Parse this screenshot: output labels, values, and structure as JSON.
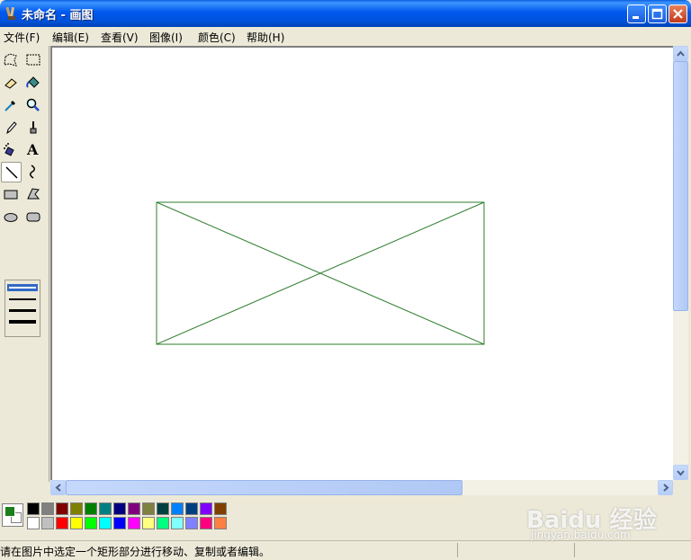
{
  "window": {
    "title": "未命名 - 画图"
  },
  "menu": [
    "文件(F)",
    "编辑(E)",
    "查看(V)",
    "图像(I)",
    "颜色(C)",
    "帮助(H)"
  ],
  "tools": [
    {
      "name": "free-select-tool",
      "icon": "free-select-icon"
    },
    {
      "name": "rect-select-tool",
      "icon": "rect-select-icon"
    },
    {
      "name": "eraser-tool",
      "icon": "eraser-icon"
    },
    {
      "name": "fill-tool",
      "icon": "paint-bucket-icon"
    },
    {
      "name": "pick-color-tool",
      "icon": "eyedropper-icon"
    },
    {
      "name": "magnifier-tool",
      "icon": "magnifier-icon"
    },
    {
      "name": "pencil-tool",
      "icon": "pencil-icon"
    },
    {
      "name": "brush-tool",
      "icon": "brush-icon"
    },
    {
      "name": "airbrush-tool",
      "icon": "airbrush-icon"
    },
    {
      "name": "text-tool",
      "icon": "text-icon",
      "glyph": "A"
    },
    {
      "name": "line-tool",
      "icon": "line-icon",
      "selected": true
    },
    {
      "name": "curve-tool",
      "icon": "curve-icon"
    },
    {
      "name": "rectangle-tool",
      "icon": "rectangle-icon"
    },
    {
      "name": "polygon-tool",
      "icon": "polygon-icon"
    },
    {
      "name": "ellipse-tool",
      "icon": "ellipse-icon"
    },
    {
      "name": "rounded-rect-tool",
      "icon": "rounded-rect-icon"
    }
  ],
  "line_sizes": {
    "selected_index": 0,
    "count": 4
  },
  "colors": {
    "foreground": "#1a7f1a",
    "background": "#ffffff",
    "stroke": "#2e7d2e",
    "palette_top": [
      "#000000",
      "#808080",
      "#800000",
      "#808000",
      "#008000",
      "#008080",
      "#000080",
      "#800080",
      "#808040",
      "#004040",
      "#0080ff",
      "#004080",
      "#8000ff",
      "#804000"
    ],
    "palette_bottom": [
      "#ffffff",
      "#c0c0c0",
      "#ff0000",
      "#ffff00",
      "#00ff00",
      "#00ffff",
      "#0000ff",
      "#ff00ff",
      "#ffff80",
      "#00ff80",
      "#80ffff",
      "#8080ff",
      "#ff0080",
      "#ff8040"
    ]
  },
  "status": {
    "text": "请在图片中选定一个矩形部分进行移动、复制或者编辑。"
  },
  "watermark": {
    "logo": "Baidu 经验",
    "url": "jingyan.baidu.com"
  }
}
